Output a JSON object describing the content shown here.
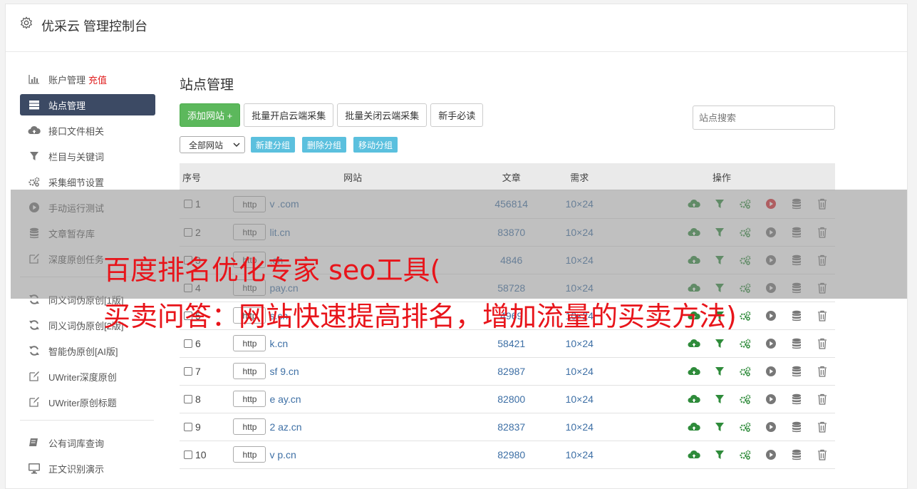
{
  "app": {
    "title": "优采云 管理控制台"
  },
  "sidebar": {
    "group1": [
      {
        "label": "账户管理",
        "extra": "充值",
        "icon": "bar-chart-icon"
      },
      {
        "label": "站点管理",
        "icon": "server-icon",
        "active": true
      },
      {
        "label": "接口文件相关",
        "icon": "cloud-upload-icon"
      },
      {
        "label": "栏目与关键词",
        "icon": "filter-icon"
      },
      {
        "label": "采集细节设置",
        "icon": "cogs-icon"
      },
      {
        "label": "手动运行测试",
        "icon": "play-circle-icon"
      },
      {
        "label": "文章暂存库",
        "icon": "database-icon"
      },
      {
        "label": "深度原创任务",
        "icon": "edit-icon"
      }
    ],
    "group2": [
      {
        "label": "同义词伪原创[1版]",
        "icon": "refresh-icon"
      },
      {
        "label": "同义词伪原创[2版]",
        "icon": "refresh-icon"
      },
      {
        "label": "智能伪原创[AI版]",
        "icon": "refresh-icon"
      },
      {
        "label": "UWriter深度原创",
        "icon": "edit-icon"
      },
      {
        "label": "UWriter原创标题",
        "icon": "edit-icon"
      }
    ],
    "group3": [
      {
        "label": "公有词库查询",
        "icon": "book-icon"
      },
      {
        "label": "正文识别演示",
        "icon": "monitor-icon"
      }
    ]
  },
  "main": {
    "title": "站点管理",
    "buttons": {
      "add": "添加网站 +",
      "batch_on": "批量开启云端采集",
      "batch_off": "批量关闭云端采集",
      "guide": "新手必读"
    },
    "search_placeholder": "站点搜索",
    "filter": {
      "selected": "全部网站",
      "new_group": "新建分组",
      "delete_group": "删除分组",
      "move_group": "移动分组"
    },
    "table": {
      "headers": {
        "no": "序号",
        "site": "网站",
        "articles": "文章",
        "demand": "需求",
        "ops": "操作"
      },
      "rows": [
        {
          "no": "1",
          "proto": "http",
          "domain": "v          .com",
          "articles": "456814",
          "demand": "10×24"
        },
        {
          "no": "2",
          "proto": "http",
          "domain": "      lit.cn",
          "articles": "83870",
          "demand": "10×24"
        },
        {
          "no": "3",
          "proto": "http",
          "domain": "       .cn",
          "articles": "4846",
          "demand": "10×24"
        },
        {
          "no": "4",
          "proto": "http",
          "domain": "      pay.cn",
          "articles": "58728",
          "demand": "10×24"
        },
        {
          "no": "5",
          "proto": "http",
          "domain": "     s.cn",
          "articles": "4969",
          "demand": "10×24"
        },
        {
          "no": "6",
          "proto": "http",
          "domain": "     k.cn",
          "articles": "58421",
          "demand": "10×24"
        },
        {
          "no": "7",
          "proto": "http",
          "domain": "sf   9.cn",
          "articles": "82987",
          "demand": "10×24"
        },
        {
          "no": "8",
          "proto": "http",
          "domain": "e     ay.cn",
          "articles": "82800",
          "demand": "10×24"
        },
        {
          "no": "9",
          "proto": "http",
          "domain": "2     az.cn",
          "articles": "82837",
          "demand": "10×24"
        },
        {
          "no": "10",
          "proto": "http",
          "domain": "v     p.cn",
          "articles": "82980",
          "demand": "10×24"
        }
      ]
    }
  },
  "watermark": {
    "line1": "百度排名优化专家 seo工具(",
    "line2": "买卖问答：网站快速提高排名，增加流量的买卖方法)"
  },
  "colors": {
    "green_btn": "#5cb85c",
    "info_btn": "#5bc0de",
    "active_nav": "#3c4a64",
    "link": "#3d6fa5",
    "watermark": "#e8141a",
    "ops_green": "#2e8b3a"
  }
}
